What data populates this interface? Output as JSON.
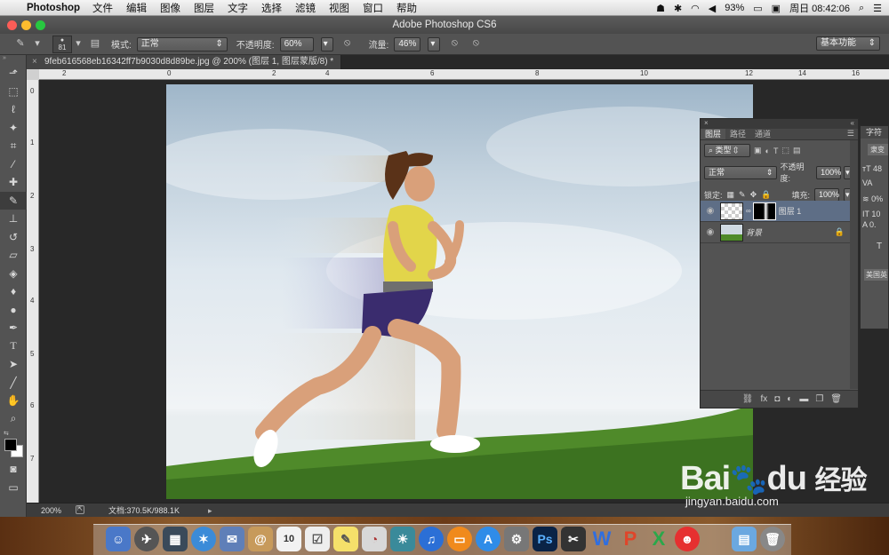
{
  "menubar": {
    "app_name": "Photoshop",
    "items": [
      "文件",
      "编辑",
      "图像",
      "图层",
      "文字",
      "选择",
      "滤镜",
      "视图",
      "窗口",
      "帮助"
    ],
    "battery": "93%",
    "clock": "周日 08:42:06"
  },
  "window": {
    "title": "Adobe Photoshop CS6"
  },
  "options": {
    "brush_size": "81",
    "mode_label": "模式:",
    "mode_value": "正常",
    "opacity_label": "不透明度:",
    "opacity_value": "60%",
    "flow_label": "流量:",
    "flow_value": "46%",
    "workspace": "基本功能"
  },
  "document": {
    "tab_title": "9feb616568eb16342ff7b9030d8d89be.jpg @ 200% (图层 1, 图层蒙版/8) *",
    "ruler_h": [
      "2",
      "0",
      "2",
      "4",
      "6",
      "8",
      "10",
      "12",
      "14",
      "16"
    ],
    "ruler_v": [
      "0",
      "1",
      "2",
      "3",
      "4",
      "5",
      "6",
      "7"
    ]
  },
  "status": {
    "zoom": "200%",
    "doc_info": "文档:370.5K/988.1K"
  },
  "layers_panel": {
    "tabs": [
      "图层",
      "路径",
      "通道"
    ],
    "filter_label": "类型",
    "blend_mode": "正常",
    "opacity_label": "不透明度:",
    "opacity_value": "100%",
    "lock_label": "锁定:",
    "fill_label": "填充:",
    "fill_value": "100%",
    "layers": [
      {
        "name": "图层 1",
        "selected": true
      },
      {
        "name": "背景",
        "selected": false
      }
    ]
  },
  "char_panel": {
    "tab": "字符",
    "font": "隶变",
    "size": "48",
    "kerning": "0%",
    "leading": "10",
    "baseline": "0.",
    "lang": "美国英"
  },
  "watermark": {
    "brand": "Bai",
    "brand2": "du",
    "cn": "经验",
    "url": "jingyan.baidu.com"
  },
  "dock": {
    "calendar_day": "10"
  },
  "colors": {
    "menubar": "#e4e4e4",
    "panel_bg": "#535353",
    "canvas_sky": "#dfe8ef",
    "grass": "#4f8a2a",
    "shirt": "#e2d54a",
    "shorts": "#3a2c6e"
  }
}
